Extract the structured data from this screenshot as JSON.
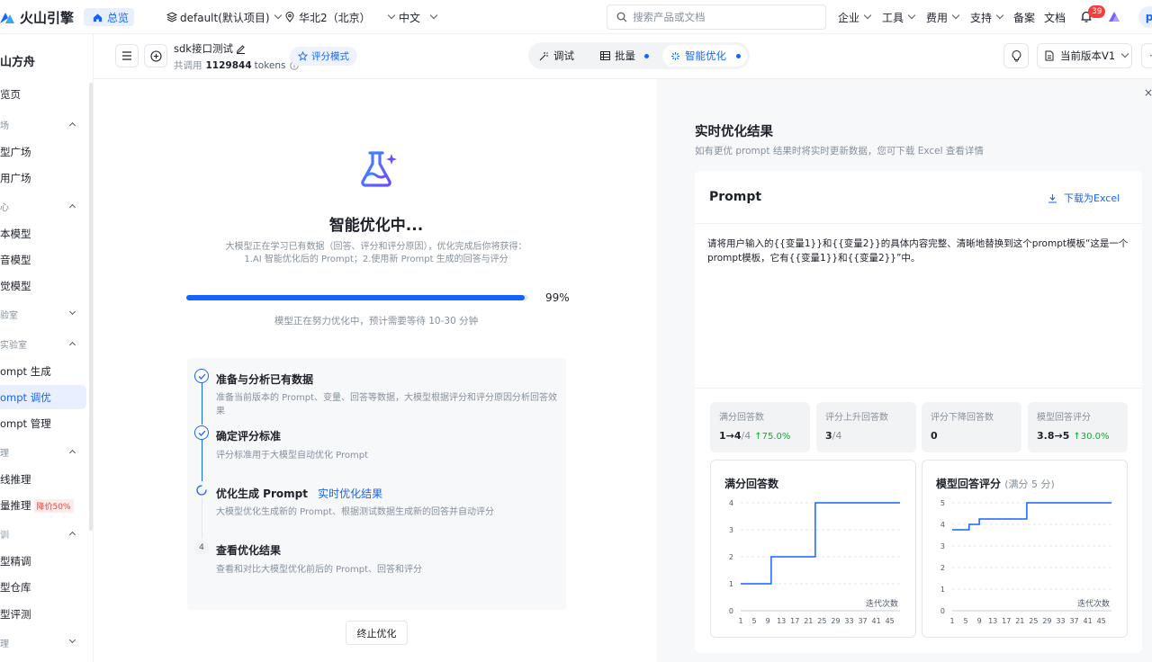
{
  "topnav": {
    "brand": "火山引擎",
    "overview_tab": "总览",
    "project": "default(默认项目)",
    "region": "华北2（北京）",
    "language": "中文",
    "search_placeholder": "搜索产品或文档",
    "menu": [
      "企业",
      "工具",
      "费用",
      "支持"
    ],
    "beian": "备案",
    "docs": "文档",
    "notification_count": "39",
    "user_initial": "p"
  },
  "sidebar": {
    "title": "山方舟",
    "items": [
      {
        "label": "览页"
      },
      {
        "label": "场"
      },
      {
        "label": "型广场"
      },
      {
        "label": "用广场"
      },
      {
        "label": "心"
      },
      {
        "label": "本模型"
      },
      {
        "label": "音模型"
      },
      {
        "label": "觉模型"
      },
      {
        "label": "验室"
      },
      {
        "label": "实验室"
      },
      {
        "label": "ompt 生成"
      },
      {
        "label": "ompt 调优"
      },
      {
        "label": "ompt 管理"
      },
      {
        "label": "理"
      },
      {
        "label": "线推理"
      },
      {
        "label": "量推理"
      },
      {
        "label": "训"
      },
      {
        "label": "型精调"
      },
      {
        "label": "型仓库"
      },
      {
        "label": "型评测"
      },
      {
        "label": "理"
      }
    ],
    "discount_badge": "降价50%"
  },
  "subheader": {
    "task_name": "sdk接口测试",
    "usage_prefix": "共调用",
    "usage_value": "1129844",
    "usage_unit": "tokens",
    "mode_badge": "评分模式",
    "tabs": [
      "调试",
      "批量",
      "智能优化"
    ],
    "version": "当前版本V1"
  },
  "optimize": {
    "title": "智能优化中...",
    "desc_line1": "大模型正在学习已有数据（回答、评分和评分原因），优化完成后你将获得：",
    "desc_line2": "1.AI 智能优化后的 Prompt；2.使用新 Prompt 生成的回答与评分",
    "progress_pct": 99,
    "progress_label": "99%",
    "eta": "模型正在努力优化中，预计需要等待 10-30 分钟",
    "steps": [
      {
        "title": "准备与分析已有数据",
        "desc": "准备当前版本的 Prompt、变量、回答等数据，大模型根据评分和评分原因分析回答效果",
        "status": "done",
        "link": ""
      },
      {
        "title": "确定评分标准",
        "desc": "评分标准用于大模型自动优化 Prompt",
        "status": "done",
        "link": ""
      },
      {
        "title": "优化生成 Prompt",
        "desc": "大模型优化生成新的 Prompt、根据测试数据生成新的回答并自动评分",
        "status": "running",
        "link": "实时优化结果"
      },
      {
        "title": "查看优化结果",
        "desc": "查看和对比大模型优化前后的 Prompt、回答和评分",
        "status": "pending",
        "number": "4",
        "link": ""
      }
    ],
    "stop_button": "终止优化"
  },
  "results": {
    "title": "实时优化结果",
    "subtitle": "如有更优 prompt 结果时将实时更新数据，您可下载 Excel 查看详情",
    "prompt_label": "Prompt",
    "download_label": "下载为Excel",
    "prompt_line1": "请将用户输入的{{变量1}}和{{变量2}}的具体内容完整、清晰地替换到这个prompt模板“这是一个",
    "prompt_line2": "prompt模板，它有{{变量1}}和{{变量2}}”中。",
    "stats": [
      {
        "label": "满分回答数",
        "value": "1→4",
        "denom": "/4",
        "delta": "↑75.0%"
      },
      {
        "label": "评分上升回答数",
        "value": "3",
        "denom": "/4",
        "delta": ""
      },
      {
        "label": "评分下降回答数",
        "value": "0",
        "denom": "",
        "delta": ""
      },
      {
        "label": "模型回答评分",
        "value": "3.8→5",
        "denom": "",
        "delta": "↑30.0%"
      }
    ]
  },
  "chart_data": [
    {
      "type": "line",
      "title": "满分回答数",
      "subtitle": "",
      "xlabel": "迭代次数",
      "ylabel": "",
      "x_ticks": [
        1,
        5,
        9,
        13,
        17,
        21,
        25,
        29,
        33,
        37,
        41,
        45
      ],
      "y_ticks": [
        0,
        1,
        2,
        3,
        4
      ],
      "ylim": [
        0,
        4
      ],
      "xlim": [
        1,
        48
      ],
      "step": true,
      "color": "#1664ff",
      "points": [
        [
          1,
          1
        ],
        [
          10,
          1
        ],
        [
          10,
          2
        ],
        [
          23,
          2
        ],
        [
          23,
          4
        ],
        [
          48,
          4
        ]
      ]
    },
    {
      "type": "line",
      "title": "模型回答评分",
      "subtitle": "(满分 5 分)",
      "xlabel": "迭代次数",
      "ylabel": "",
      "x_ticks": [
        1,
        5,
        9,
        13,
        17,
        21,
        25,
        29,
        33,
        37,
        41,
        45
      ],
      "y_ticks": [
        0,
        1,
        2,
        3,
        4,
        5
      ],
      "ylim": [
        0,
        5
      ],
      "xlim": [
        1,
        48
      ],
      "step": true,
      "color": "#1664ff",
      "points": [
        [
          1,
          3.75
        ],
        [
          6,
          3.75
        ],
        [
          6,
          4.0
        ],
        [
          9,
          4.0
        ],
        [
          9,
          4.25
        ],
        [
          23,
          4.25
        ],
        [
          23,
          5.0
        ],
        [
          48,
          5.0
        ]
      ]
    }
  ],
  "colors": {
    "accent": "#1664ff",
    "up": "#00b42a",
    "badge_bg": "#ffece8",
    "badge_text": "#f53f3f"
  }
}
